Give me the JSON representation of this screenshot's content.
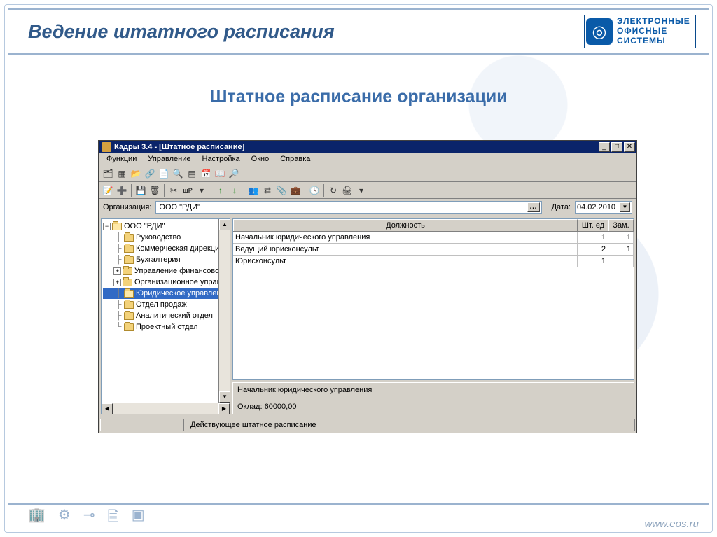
{
  "slide": {
    "title": "Ведение штатного расписания",
    "subtitle": "Штатное расписание организации"
  },
  "logo": {
    "line1": "ЭЛЕКТРОННЫЕ",
    "line2": "ОФИСНЫЕ",
    "line3": "СИСТЕМЫ"
  },
  "footer": {
    "url": "www.eos.ru"
  },
  "app": {
    "window_title": "Кадры 3.4 - [Штатное расписание]",
    "menu": [
      "Функции",
      "Управление",
      "Настройка",
      "Окно",
      "Справка"
    ],
    "org_label": "Организация:",
    "org_value": "ООО \"РДИ\"",
    "date_label": "Дата:",
    "date_value": "04.02.2010",
    "tree": {
      "root": "ООО \"РДИ\"",
      "children": [
        "Руководство",
        "Коммерческая дирекция",
        "Бухгалтерия",
        "Управление финансовов",
        "Организационное управле",
        "Юридическое управление",
        "Отдел продаж",
        "Аналитический отдел",
        "Проектный отдел"
      ],
      "selected_index": 5
    },
    "grid": {
      "headers": {
        "col1": "Должность",
        "col2": "Шт. ед",
        "col3": "Зам."
      },
      "rows": [
        {
          "position": "Начальник юридического управления",
          "units": "1",
          "deputies": "1"
        },
        {
          "position": "Ведущий юрисконсульт",
          "units": "2",
          "deputies": "1"
        },
        {
          "position": "Юрисконсульт",
          "units": "1",
          "deputies": ""
        }
      ]
    },
    "detail": {
      "position": "Начальник юридического управления",
      "salary_label": "Оклад:",
      "salary_value": "60000,00"
    },
    "status": {
      "left": "",
      "right": "Действующее штатное расписание"
    }
  }
}
